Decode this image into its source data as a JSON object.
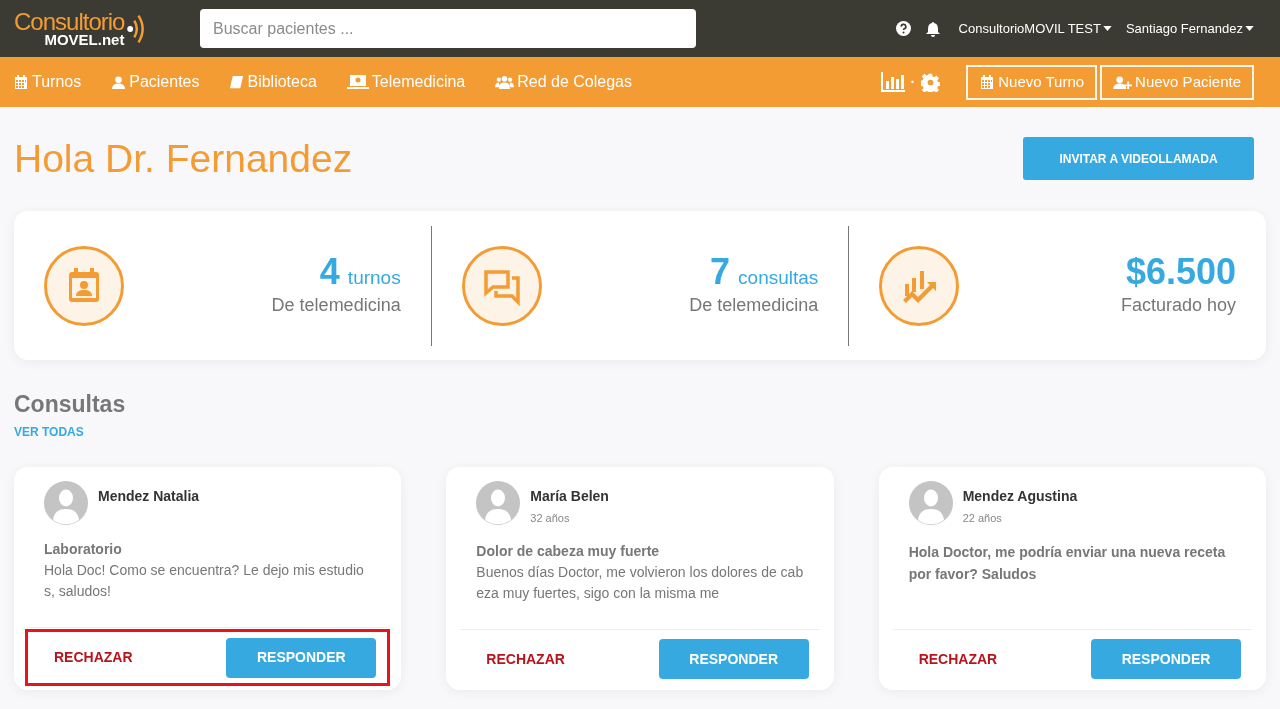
{
  "header": {
    "logo_top": "Consultorio",
    "logo_bottom": "MOVEL.net",
    "search": {
      "placeholder": "Buscar pacientes ..."
    },
    "account": "ConsultorioMOVIL TEST",
    "user": "Santiago Fernandez"
  },
  "nav": {
    "items": [
      {
        "label": "Turnos"
      },
      {
        "label": "Pacientes"
      },
      {
        "label": "Biblioteca"
      },
      {
        "label": "Telemedicina"
      },
      {
        "label": "Red de Colegas"
      }
    ],
    "separator": "·",
    "buttons": [
      {
        "label": "Nuevo Turno"
      },
      {
        "label": "Nuevo Paciente"
      }
    ]
  },
  "greeting": "Hola Dr. Fernandez",
  "invite_button": "INVITAR A VIDEOLLAMADA",
  "stats": [
    {
      "number": "4",
      "unit": "turnos",
      "caption": "De telemedicina"
    },
    {
      "number": "7",
      "unit": "consultas",
      "caption": "De telemedicina"
    },
    {
      "number": "$6.500",
      "caption": "Facturado hoy"
    }
  ],
  "consultas": {
    "title": "Consultas",
    "link": "VER TODAS",
    "cards": [
      {
        "name": "Mendez Natalia",
        "kind": "with_subject",
        "subject": "Laboratorio",
        "message": "Hola Doc! Como se encuentra? Le dejo mis estudios, saludos!",
        "reject": "RECHAZAR",
        "reply": "RESPONDER",
        "highlighted": true
      },
      {
        "name": "María Belen",
        "age": "32 años",
        "kind": "with_subject",
        "subject": "Dolor de cabeza muy fuerte",
        "message": "Buenos días Doctor, me volvieron los dolores de cabeza muy fuertes, sigo con la misma me",
        "reject": "RECHAZAR",
        "reply": "RESPONDER",
        "highlighted": false
      },
      {
        "name": "Mendez Agustina",
        "age": "22 años",
        "kind": "message_only",
        "message": "Hola Doctor, me podría enviar una nueva receta por favor? Saludos",
        "reject": "RECHAZAR",
        "reply": "RESPONDER",
        "highlighted": false
      }
    ]
  }
}
